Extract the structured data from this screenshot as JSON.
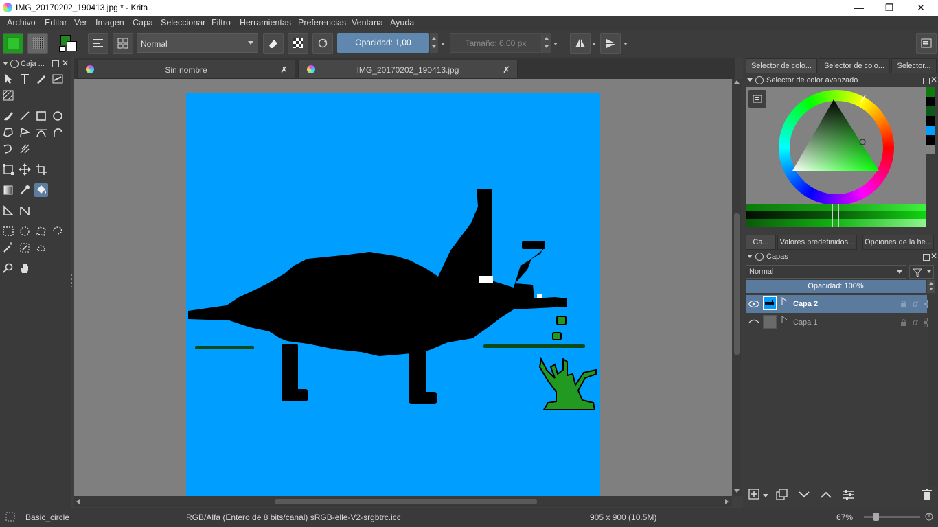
{
  "window": {
    "title": "IMG_20170202_190413.jpg * - Krita",
    "minimize": "—",
    "restore": "❐",
    "close": "✕"
  },
  "menu": [
    "Archivo",
    "Editar",
    "Ver",
    "Imagen",
    "Capa",
    "Seleccionar",
    "Filtro",
    "Herramientas",
    "Preferencias",
    "Ventana",
    "Ayuda"
  ],
  "toolbar": {
    "blend_mode": "Normal",
    "opacity_label": "Opacidad:",
    "opacity_value": "1,00",
    "size_label": "Tamaño:",
    "size_value": "6,00 px",
    "fg_color": "#1f8a1f",
    "bg_color": "#ffffff"
  },
  "toolbox": {
    "title": "Caja ..."
  },
  "tabs": [
    {
      "label": "Sin nombre",
      "close": "✗"
    },
    {
      "label": "IMG_20170202_190413.jpg",
      "close": "✗"
    }
  ],
  "canvas": {
    "background_color": "#009fff"
  },
  "color_docker": {
    "tabs": [
      "Selector de colo...",
      "Selector de colo...",
      "Selector..."
    ],
    "title": "Selector de color avanzado",
    "current_color": "#12d412"
  },
  "layers_docker": {
    "tabs": [
      "Ca...",
      "Valores predefinidos...",
      "Opciones de la he..."
    ],
    "title": "Capas",
    "blend_mode": "Normal",
    "opacity": "Opacidad:  100%",
    "layers": [
      {
        "name": "Capa 2",
        "selected": true
      },
      {
        "name": "Capa 1",
        "selected": false
      }
    ]
  },
  "status": {
    "brush": "Basic_circle",
    "color_space": "RGB/Alfa (Entero de 8 bits/canal)  sRGB-elle-V2-srgbtrc.icc",
    "dimensions": "905 x 900 (10.5M)",
    "zoom": "67%"
  }
}
